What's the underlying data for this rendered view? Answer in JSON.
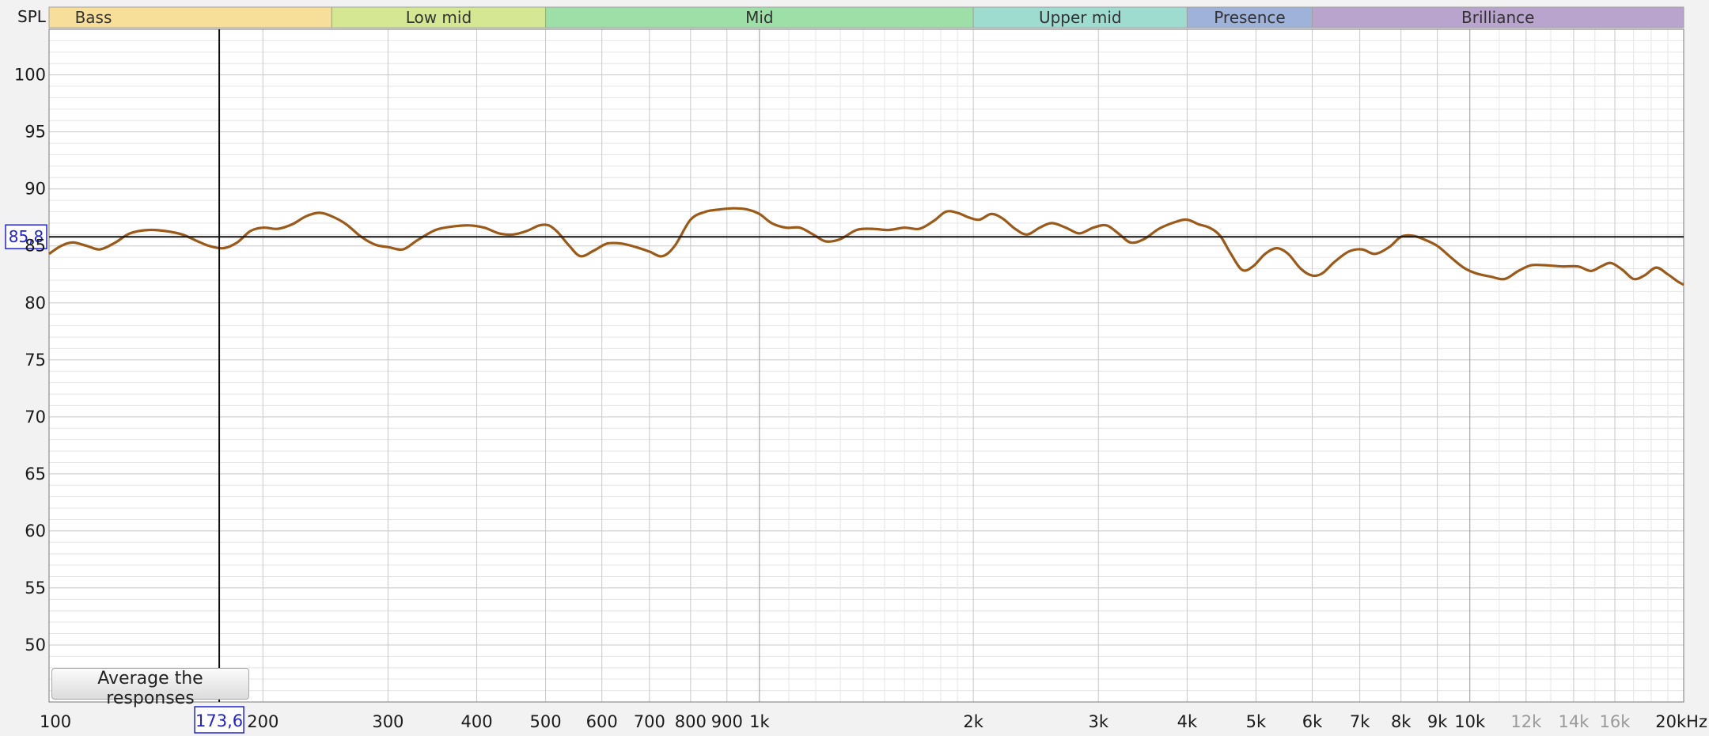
{
  "app": {
    "button_label": "Average the responses"
  },
  "chart_data": {
    "type": "line",
    "x_scale": "log",
    "y_label": "SPL",
    "x_unit": "kHz",
    "xlim": [
      100,
      20000
    ],
    "ylim": [
      45,
      104
    ],
    "grid": true,
    "bands": [
      {
        "name": "Bass",
        "from": 100,
        "to": 250,
        "color": "#f7df9a"
      },
      {
        "name": "Low mid",
        "from": 250,
        "to": 500,
        "color": "#d6e794"
      },
      {
        "name": "Mid",
        "from": 500,
        "to": 2000,
        "color": "#9ddfa6"
      },
      {
        "name": "Upper mid",
        "from": 2000,
        "to": 4000,
        "color": "#9edccf"
      },
      {
        "name": "Presence",
        "from": 4000,
        "to": 6000,
        "color": "#9eb2da"
      },
      {
        "name": "Brilliance",
        "from": 6000,
        "to": 20000,
        "color": "#b9a4ce"
      }
    ],
    "y_ticks": [
      50,
      55,
      60,
      65,
      70,
      75,
      80,
      85,
      90,
      95,
      100
    ],
    "y_tick_labels": [
      "50",
      "55",
      "60",
      "65",
      "70",
      "75",
      "80",
      "85",
      "90",
      "95",
      "100"
    ],
    "x_ticks": [
      {
        "value": 100,
        "label": "100",
        "muted": false
      },
      {
        "value": 200,
        "label": "200",
        "muted": false
      },
      {
        "value": 300,
        "label": "300",
        "muted": false
      },
      {
        "value": 400,
        "label": "400",
        "muted": false
      },
      {
        "value": 500,
        "label": "500",
        "muted": false
      },
      {
        "value": 600,
        "label": "600",
        "muted": false
      },
      {
        "value": 700,
        "label": "700",
        "muted": false
      },
      {
        "value": 800,
        "label": "800",
        "muted": false
      },
      {
        "value": 900,
        "label": "900",
        "muted": false
      },
      {
        "value": 1000,
        "label": "1k",
        "muted": false
      },
      {
        "value": 2000,
        "label": "2k",
        "muted": false
      },
      {
        "value": 3000,
        "label": "3k",
        "muted": false
      },
      {
        "value": 4000,
        "label": "4k",
        "muted": false
      },
      {
        "value": 5000,
        "label": "5k",
        "muted": false
      },
      {
        "value": 6000,
        "label": "6k",
        "muted": false
      },
      {
        "value": 7000,
        "label": "7k",
        "muted": false
      },
      {
        "value": 8000,
        "label": "8k",
        "muted": false
      },
      {
        "value": 9000,
        "label": "9k",
        "muted": false
      },
      {
        "value": 10000,
        "label": "10k",
        "muted": false
      },
      {
        "value": 12000,
        "label": "12k",
        "muted": true
      },
      {
        "value": 14000,
        "label": "14k",
        "muted": true
      },
      {
        "value": 16000,
        "label": "16k",
        "muted": true
      },
      {
        "value": 20000,
        "label": "20kHz",
        "muted": false
      }
    ],
    "cursor": {
      "x": 173.6,
      "y": 85.8,
      "x_label": "173,6",
      "y_label": "85,8"
    },
    "series": [
      {
        "color": "#9b5a1a",
        "points": [
          [
            100,
            84.3
          ],
          [
            104,
            85.0
          ],
          [
            108,
            85.3
          ],
          [
            113,
            85.0
          ],
          [
            118,
            84.7
          ],
          [
            124,
            85.3
          ],
          [
            130,
            86.1
          ],
          [
            138,
            86.4
          ],
          [
            146,
            86.3
          ],
          [
            154,
            86.0
          ],
          [
            162,
            85.4
          ],
          [
            168,
            85.0
          ],
          [
            176,
            84.8
          ],
          [
            184,
            85.3
          ],
          [
            192,
            86.3
          ],
          [
            200,
            86.6
          ],
          [
            210,
            86.5
          ],
          [
            220,
            86.9
          ],
          [
            230,
            87.6
          ],
          [
            240,
            87.9
          ],
          [
            250,
            87.6
          ],
          [
            262,
            86.9
          ],
          [
            275,
            85.8
          ],
          [
            288,
            85.1
          ],
          [
            300,
            84.9
          ],
          [
            315,
            84.7
          ],
          [
            330,
            85.5
          ],
          [
            350,
            86.4
          ],
          [
            370,
            86.7
          ],
          [
            390,
            86.8
          ],
          [
            410,
            86.6
          ],
          [
            430,
            86.1
          ],
          [
            450,
            86.0
          ],
          [
            470,
            86.3
          ],
          [
            490,
            86.8
          ],
          [
            505,
            86.8
          ],
          [
            520,
            86.2
          ],
          [
            540,
            85.0
          ],
          [
            560,
            84.1
          ],
          [
            585,
            84.6
          ],
          [
            610,
            85.2
          ],
          [
            640,
            85.2
          ],
          [
            670,
            84.9
          ],
          [
            700,
            84.5
          ],
          [
            730,
            84.1
          ],
          [
            760,
            85.0
          ],
          [
            800,
            87.3
          ],
          [
            840,
            88.0
          ],
          [
            880,
            88.2
          ],
          [
            920,
            88.3
          ],
          [
            960,
            88.2
          ],
          [
            1000,
            87.8
          ],
          [
            1040,
            87.0
          ],
          [
            1090,
            86.6
          ],
          [
            1140,
            86.6
          ],
          [
            1190,
            86.0
          ],
          [
            1240,
            85.4
          ],
          [
            1300,
            85.6
          ],
          [
            1370,
            86.4
          ],
          [
            1440,
            86.5
          ],
          [
            1520,
            86.4
          ],
          [
            1600,
            86.6
          ],
          [
            1680,
            86.5
          ],
          [
            1760,
            87.2
          ],
          [
            1830,
            88.0
          ],
          [
            1900,
            87.9
          ],
          [
            1970,
            87.5
          ],
          [
            2040,
            87.3
          ],
          [
            2120,
            87.8
          ],
          [
            2200,
            87.4
          ],
          [
            2290,
            86.5
          ],
          [
            2380,
            86.0
          ],
          [
            2480,
            86.6
          ],
          [
            2580,
            87.0
          ],
          [
            2700,
            86.6
          ],
          [
            2820,
            86.1
          ],
          [
            2950,
            86.6
          ],
          [
            3080,
            86.8
          ],
          [
            3200,
            86.1
          ],
          [
            3330,
            85.3
          ],
          [
            3480,
            85.6
          ],
          [
            3650,
            86.5
          ],
          [
            3850,
            87.1
          ],
          [
            4000,
            87.3
          ],
          [
            4150,
            86.9
          ],
          [
            4300,
            86.6
          ],
          [
            4450,
            85.9
          ],
          [
            4600,
            84.4
          ],
          [
            4780,
            82.9
          ],
          [
            4950,
            83.2
          ],
          [
            5150,
            84.3
          ],
          [
            5350,
            84.8
          ],
          [
            5550,
            84.3
          ],
          [
            5780,
            83.0
          ],
          [
            6000,
            82.4
          ],
          [
            6200,
            82.6
          ],
          [
            6450,
            83.6
          ],
          [
            6750,
            84.5
          ],
          [
            7050,
            84.7
          ],
          [
            7350,
            84.3
          ],
          [
            7700,
            84.9
          ],
          [
            8000,
            85.8
          ],
          [
            8300,
            85.9
          ],
          [
            8600,
            85.6
          ],
          [
            9000,
            85.0
          ],
          [
            9400,
            84.0
          ],
          [
            9800,
            83.1
          ],
          [
            10200,
            82.6
          ],
          [
            10700,
            82.3
          ],
          [
            11200,
            82.1
          ],
          [
            11700,
            82.8
          ],
          [
            12200,
            83.3
          ],
          [
            12800,
            83.3
          ],
          [
            13500,
            83.2
          ],
          [
            14200,
            83.2
          ],
          [
            14800,
            82.8
          ],
          [
            15300,
            83.2
          ],
          [
            15800,
            83.5
          ],
          [
            16400,
            82.9
          ],
          [
            17000,
            82.1
          ],
          [
            17600,
            82.4
          ],
          [
            18300,
            83.1
          ],
          [
            19000,
            82.5
          ],
          [
            19600,
            81.9
          ],
          [
            20000,
            81.6
          ]
        ]
      }
    ]
  }
}
